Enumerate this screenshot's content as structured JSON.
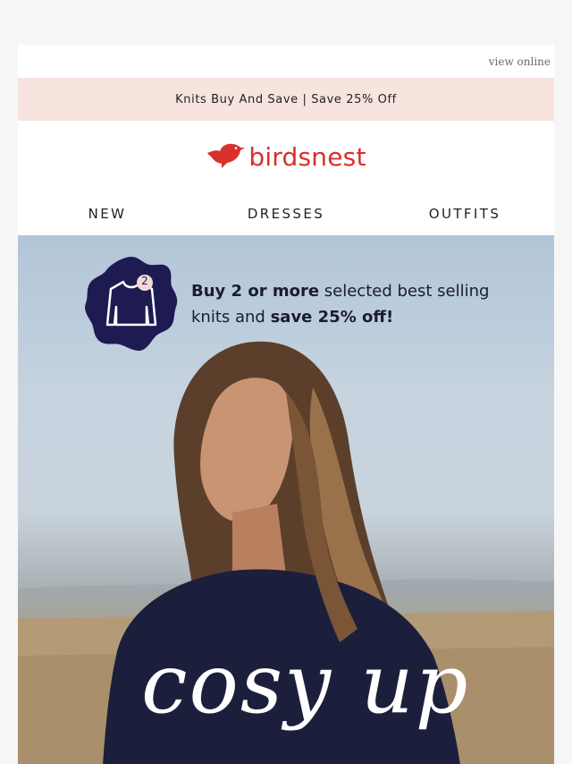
{
  "topbar": {
    "view_online": "view online"
  },
  "promo": {
    "text": "Knits Buy And Save | Save 25% Off"
  },
  "brand": {
    "name": "birdsnest",
    "color": "#d7312a",
    "icon": "bird-logo-icon"
  },
  "nav": {
    "items": [
      {
        "label": "NEW"
      },
      {
        "label": "DRESSES"
      },
      {
        "label": "OUTFITS"
      }
    ]
  },
  "hero": {
    "badge": {
      "icon": "sweater-icon",
      "count": "2",
      "color": "#1e1a52"
    },
    "offer": {
      "part1": "Buy 2 or more",
      "part2": " selected best selling knits and ",
      "part3": "save 25% off!"
    },
    "headline": "cosy up"
  }
}
